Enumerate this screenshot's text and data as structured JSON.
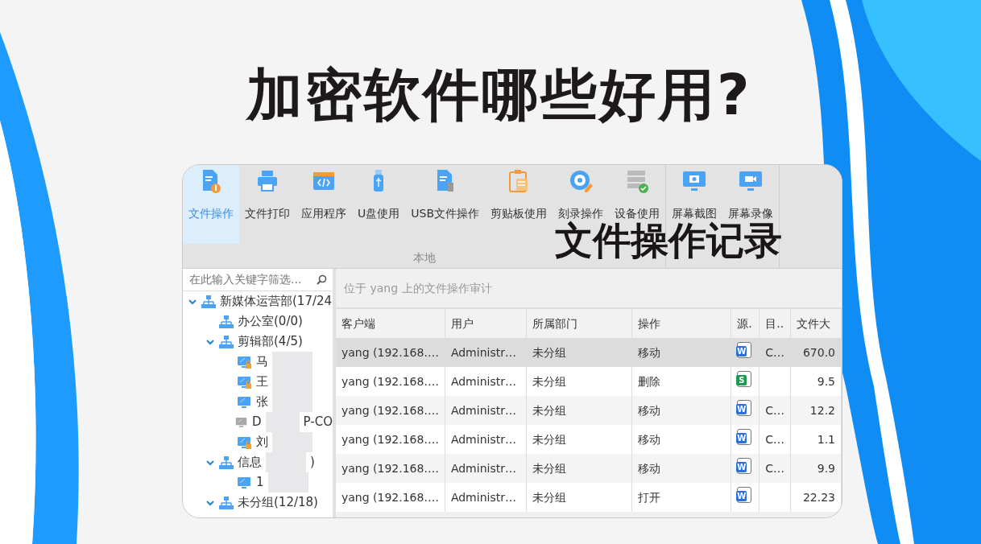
{
  "headline": "加密软件哪些好用?",
  "caption": "文件操作记录",
  "toolbar": {
    "groups": [
      {
        "label": "本地",
        "buttons": [
          {
            "label": "文件操作",
            "kind": "file-op",
            "selected": true
          },
          {
            "label": "文件打印",
            "kind": "print",
            "selected": false
          },
          {
            "label": "应用程序",
            "kind": "app",
            "selected": false
          },
          {
            "label": "U盘使用",
            "kind": "udisk",
            "selected": false
          },
          {
            "label": "USB文件操作",
            "kind": "usb-file",
            "selected": false
          },
          {
            "label": "剪贴板使用",
            "kind": "clipboard",
            "selected": false
          },
          {
            "label": "刻录操作",
            "kind": "burn",
            "selected": false
          },
          {
            "label": "设备使用",
            "kind": "device",
            "selected": false
          }
        ]
      },
      {
        "buttons": [
          {
            "label": "屏幕截图",
            "kind": "screenshot",
            "selected": false
          },
          {
            "label": "屏幕录像",
            "kind": "record",
            "selected": false
          }
        ]
      }
    ]
  },
  "sidebar": {
    "search": {
      "placeholder": "在此输入关键字筛选..."
    },
    "tree": [
      {
        "label": "新媒体运营部(17/24",
        "kind": "group",
        "expanded": true,
        "children": [
          {
            "label": "办公室(0/0)",
            "kind": "group"
          },
          {
            "label": "剪辑部(4/5)",
            "kind": "group",
            "expanded": true,
            "children": [
              {
                "label": "马",
                "kind": "computer",
                "online": true,
                "locked": true,
                "redacted": true
              },
              {
                "label": "王",
                "kind": "computer",
                "online": true,
                "locked": true,
                "redacted": true
              },
              {
                "label": "张",
                "kind": "computer",
                "online": true,
                "locked": false,
                "redacted": true
              },
              {
                "label": "D",
                "label_tail": "P-CO",
                "kind": "computer",
                "online": false,
                "locked": false,
                "redacted": true
              },
              {
                "label": "刘",
                "kind": "computer",
                "online": true,
                "locked": true,
                "redacted": true
              }
            ]
          },
          {
            "label": "信息",
            "label_tail": ")",
            "kind": "group",
            "expanded": true,
            "redacted": true,
            "children": [
              {
                "label": "1",
                "kind": "computer",
                "online": true,
                "locked": false,
                "redacted": true
              }
            ]
          },
          {
            "label": "未分组(12/18)",
            "kind": "group",
            "expanded": true
          }
        ]
      }
    ]
  },
  "panel": {
    "heading": "位于 yang 上的文件操作审计",
    "table": {
      "columns": [
        "客户端",
        "用户",
        "所属部门",
        "操作",
        "源.",
        "目..",
        "文件大"
      ],
      "rows": [
        {
          "selected": true,
          "source": {
            "kind": "word",
            "letter": "W"
          },
          "cells": [
            "yang (192.168.…",
            "Administr…",
            "未分组",
            "移动",
            "",
            "C…",
            "670.0"
          ]
        },
        {
          "selected": false,
          "source": {
            "kind": "sheet",
            "letter": "S"
          },
          "cells": [
            "yang (192.168.…",
            "Administr…",
            "未分组",
            "删除",
            "",
            "",
            "9.5"
          ]
        },
        {
          "selected": false,
          "source": {
            "kind": "word",
            "letter": "W"
          },
          "cells": [
            "yang (192.168.…",
            "Administr…",
            "未分组",
            "移动",
            "",
            "C…",
            "12.2"
          ]
        },
        {
          "selected": false,
          "source": {
            "kind": "word",
            "letter": "W"
          },
          "cells": [
            "yang (192.168.…",
            "Administr…",
            "未分组",
            "移动",
            "",
            "C…",
            "1.1"
          ]
        },
        {
          "selected": false,
          "source": {
            "kind": "word",
            "letter": "W"
          },
          "cells": [
            "yang (192.168.…",
            "Administr…",
            "未分组",
            "移动",
            "",
            "C…",
            "9.9"
          ]
        },
        {
          "selected": false,
          "source": {
            "kind": "word",
            "letter": "W"
          },
          "cells": [
            "yang (192.168.…",
            "Administr…",
            "未分组",
            "打开",
            "",
            "",
            "22.23"
          ]
        }
      ]
    }
  }
}
